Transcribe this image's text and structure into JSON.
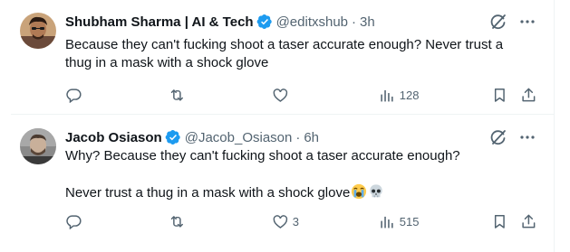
{
  "tweets": [
    {
      "display_name": "Shubham Sharma | AI & Tech",
      "handle": "@editxshub",
      "separator": "·",
      "time": "3h",
      "text": "Because they can't fucking shoot a taser accurate enough? Never trust a\nthug in a mask with a shock glove",
      "emojis": [],
      "reply_count": "",
      "retweet_count": "",
      "like_count": "",
      "view_count": "128"
    },
    {
      "display_name": "Jacob Osiason",
      "handle": "@Jacob_Osiason",
      "separator": "·",
      "time": "6h",
      "text": "Why? Because they can't fucking shoot a taser accurate enough?\n\nNever trust a thug in a mask with a shock glove",
      "emojis": [
        "loudly-crying-face-emoji",
        "skull-emoji"
      ],
      "reply_count": "",
      "retweet_count": "",
      "like_count": "3",
      "view_count": "515"
    }
  ],
  "colors": {
    "text_primary": "#0f1419",
    "text_secondary": "#536471",
    "verified_blue": "#1d9bf0",
    "divider": "#eff3f4"
  },
  "icons": [
    "grok-icon",
    "more-icon",
    "reply-icon",
    "retweet-icon",
    "like-icon",
    "views-icon",
    "bookmark-icon",
    "share-icon",
    "verified-badge-icon"
  ]
}
